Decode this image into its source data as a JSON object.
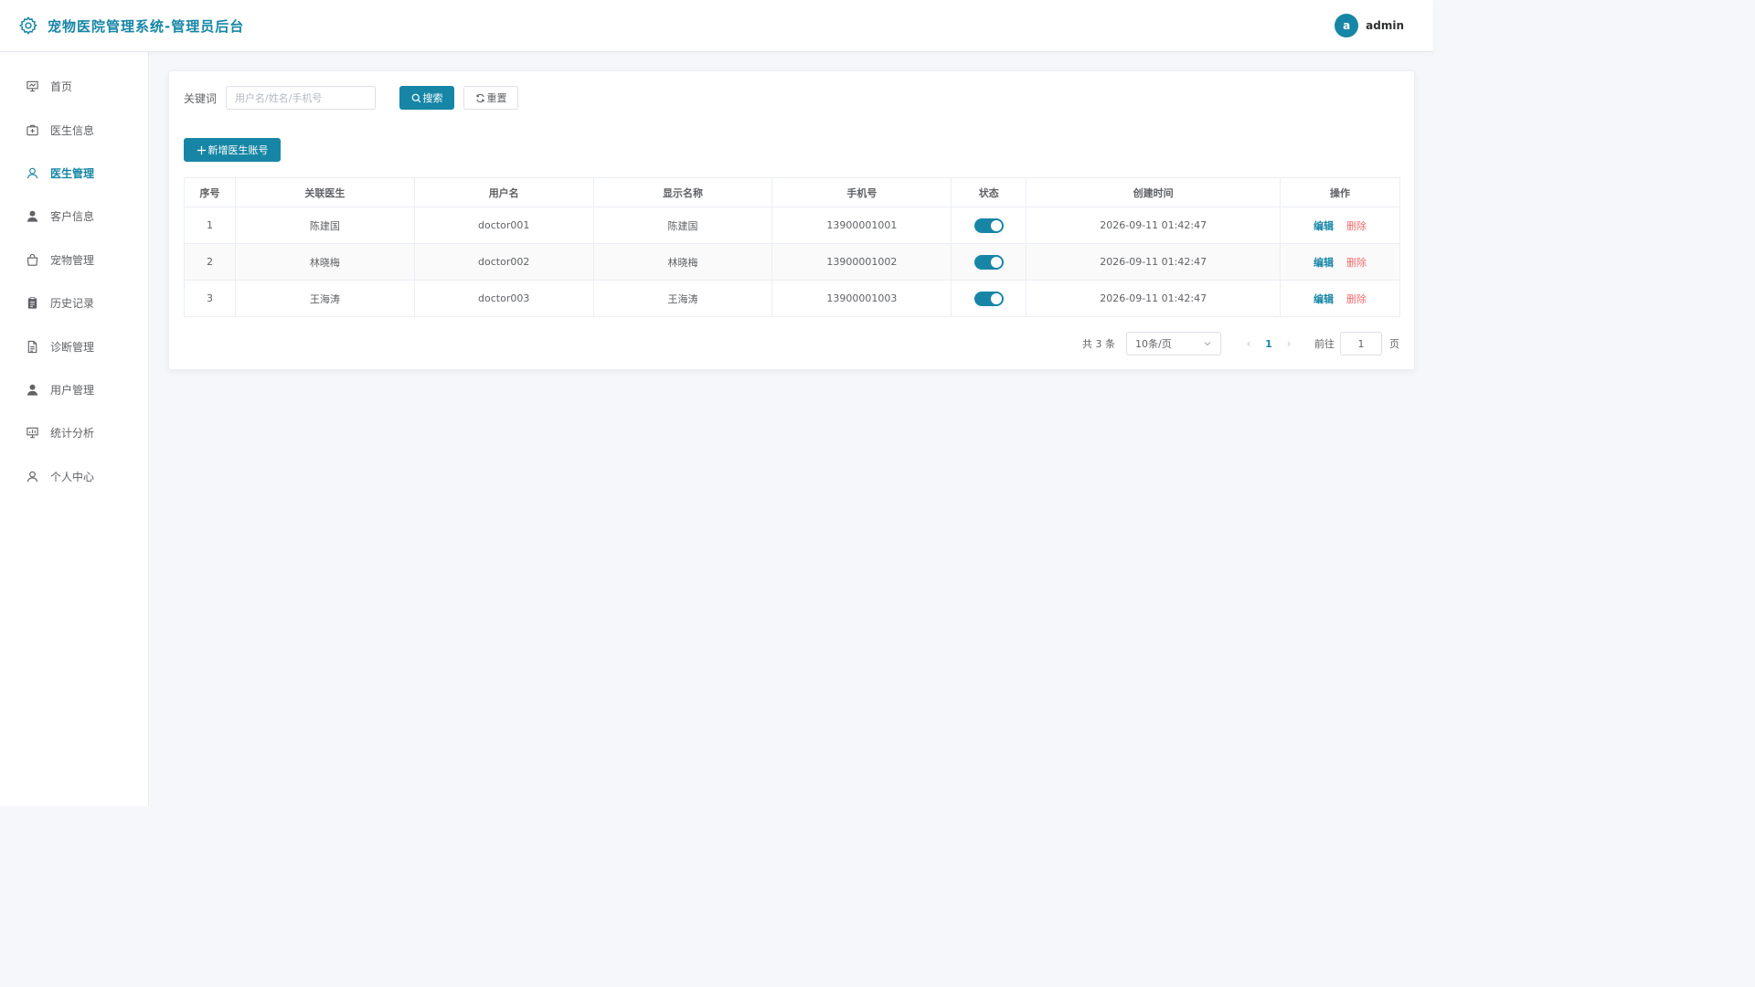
{
  "header": {
    "title": "宠物医院管理系统-管理员后台",
    "avatar_letter": "a",
    "username": "admin"
  },
  "sidebar": {
    "items": [
      {
        "label": "首页",
        "icon": "presentation-icon",
        "active": false
      },
      {
        "label": "医生信息",
        "icon": "medical-box-icon",
        "active": false
      },
      {
        "label": "医生管理",
        "icon": "user-icon",
        "active": true
      },
      {
        "label": "客户信息",
        "icon": "user-filled-icon",
        "active": false
      },
      {
        "label": "宠物管理",
        "icon": "bag-icon",
        "active": false
      },
      {
        "label": "历史记录",
        "icon": "clipboard-icon",
        "active": false
      },
      {
        "label": "诊断管理",
        "icon": "document-icon",
        "active": false
      },
      {
        "label": "用户管理",
        "icon": "user-filled-icon",
        "active": false
      },
      {
        "label": "统计分析",
        "icon": "chart-board-icon",
        "active": false
      },
      {
        "label": "个人中心",
        "icon": "user-icon",
        "active": false
      }
    ]
  },
  "search": {
    "label": "关键词",
    "placeholder": "用户名/姓名/手机号",
    "search_label": "搜索",
    "reset_label": "重置"
  },
  "add_button_label": "新增医生账号",
  "table": {
    "columns": [
      "序号",
      "关联医生",
      "用户名",
      "显示名称",
      "手机号",
      "状态",
      "创建时间",
      "操作"
    ],
    "rows": [
      {
        "index": "1",
        "doctor": "陈建国",
        "username": "doctor001",
        "display_name": "陈建国",
        "phone": "13900001001",
        "enabled": true,
        "created": "2026-09-11 01:42:47"
      },
      {
        "index": "2",
        "doctor": "林晓梅",
        "username": "doctor002",
        "display_name": "林晓梅",
        "phone": "13900001002",
        "enabled": true,
        "created": "2026-09-11 01:42:47"
      },
      {
        "index": "3",
        "doctor": "王海涛",
        "username": "doctor003",
        "display_name": "王海涛",
        "phone": "13900001003",
        "enabled": true,
        "created": "2026-09-11 01:42:47"
      }
    ],
    "edit_label": "编辑",
    "delete_label": "删除"
  },
  "pagination": {
    "total": "共 3 条",
    "page_size": "10条/页",
    "current_page": "1",
    "goto_label": "前往",
    "goto_value": "1",
    "goto_suffix": "页"
  },
  "colors": {
    "primary": "#1786a6",
    "danger": "#f56c6c"
  }
}
